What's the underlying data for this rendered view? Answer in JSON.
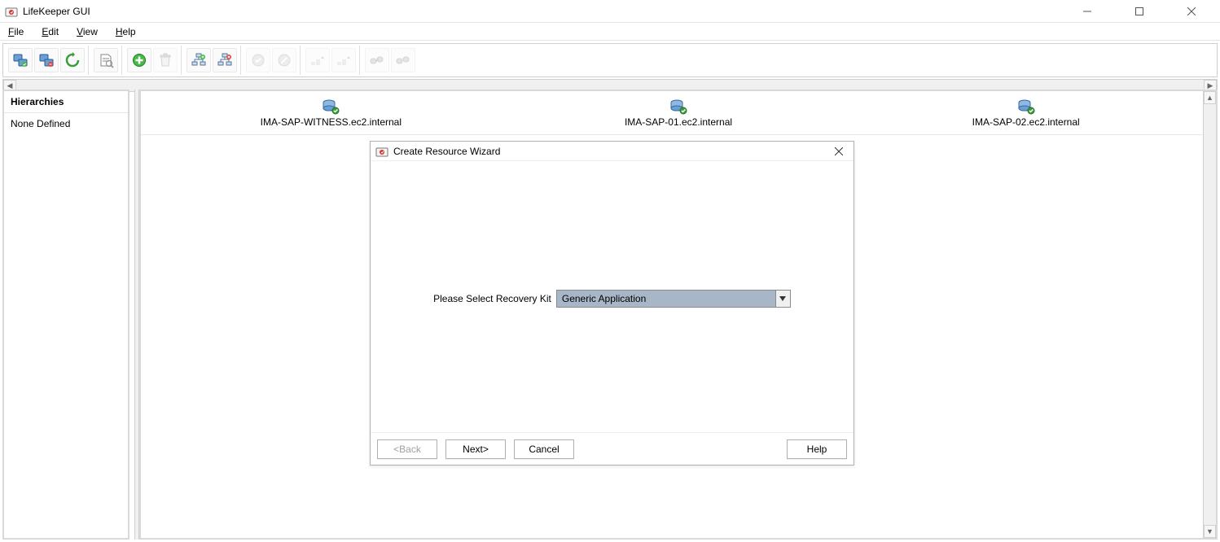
{
  "window": {
    "title": "LifeKeeper GUI"
  },
  "menubar": {
    "file": "File",
    "file_u": "F",
    "edit": "Edit",
    "edit_u": "E",
    "view": "View",
    "view_u": "V",
    "help": "Help",
    "help_u": "H"
  },
  "sidebar": {
    "header": "Hierarchies",
    "empty_text": "None Defined"
  },
  "servers": [
    {
      "name": "IMA-SAP-WITNESS.ec2.internal"
    },
    {
      "name": "IMA-SAP-01.ec2.internal"
    },
    {
      "name": "IMA-SAP-02.ec2.internal"
    }
  ],
  "dialog": {
    "title": "Create Resource Wizard",
    "prompt": "Please Select Recovery Kit",
    "selected": "Generic Application",
    "buttons": {
      "back": "<Back",
      "next": "Next>",
      "cancel": "Cancel",
      "help": "Help"
    }
  }
}
